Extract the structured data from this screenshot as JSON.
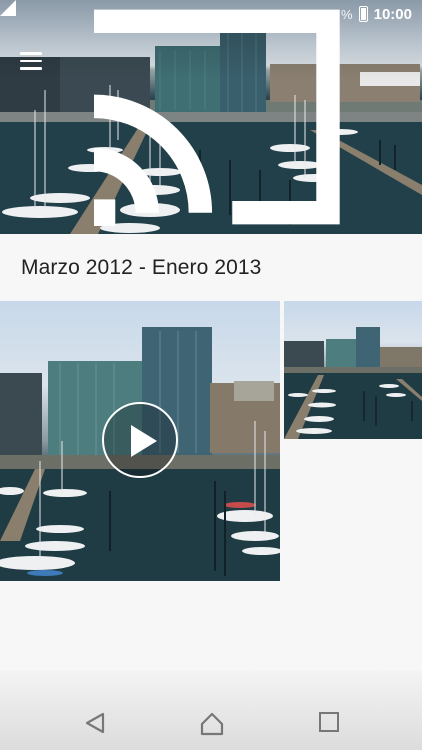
{
  "status_bar": {
    "battery_percent": "100 %",
    "time": "10:00"
  },
  "header": {
    "menu_icon": "hamburger-menu-icon",
    "cast_icon": "cast-icon"
  },
  "album": {
    "title": "Marzo 2012 - Enero 2013"
  },
  "items": [
    {
      "type": "video",
      "play_icon": "play-icon"
    },
    {
      "type": "photo"
    }
  ],
  "navigation": {
    "back_icon": "back-triangle-icon",
    "home_icon": "home-icon",
    "recent_icon": "recent-apps-icon"
  },
  "colors": {
    "title_text": "#222222",
    "background": "#f7f7f7",
    "nav_icon": "#777777"
  }
}
